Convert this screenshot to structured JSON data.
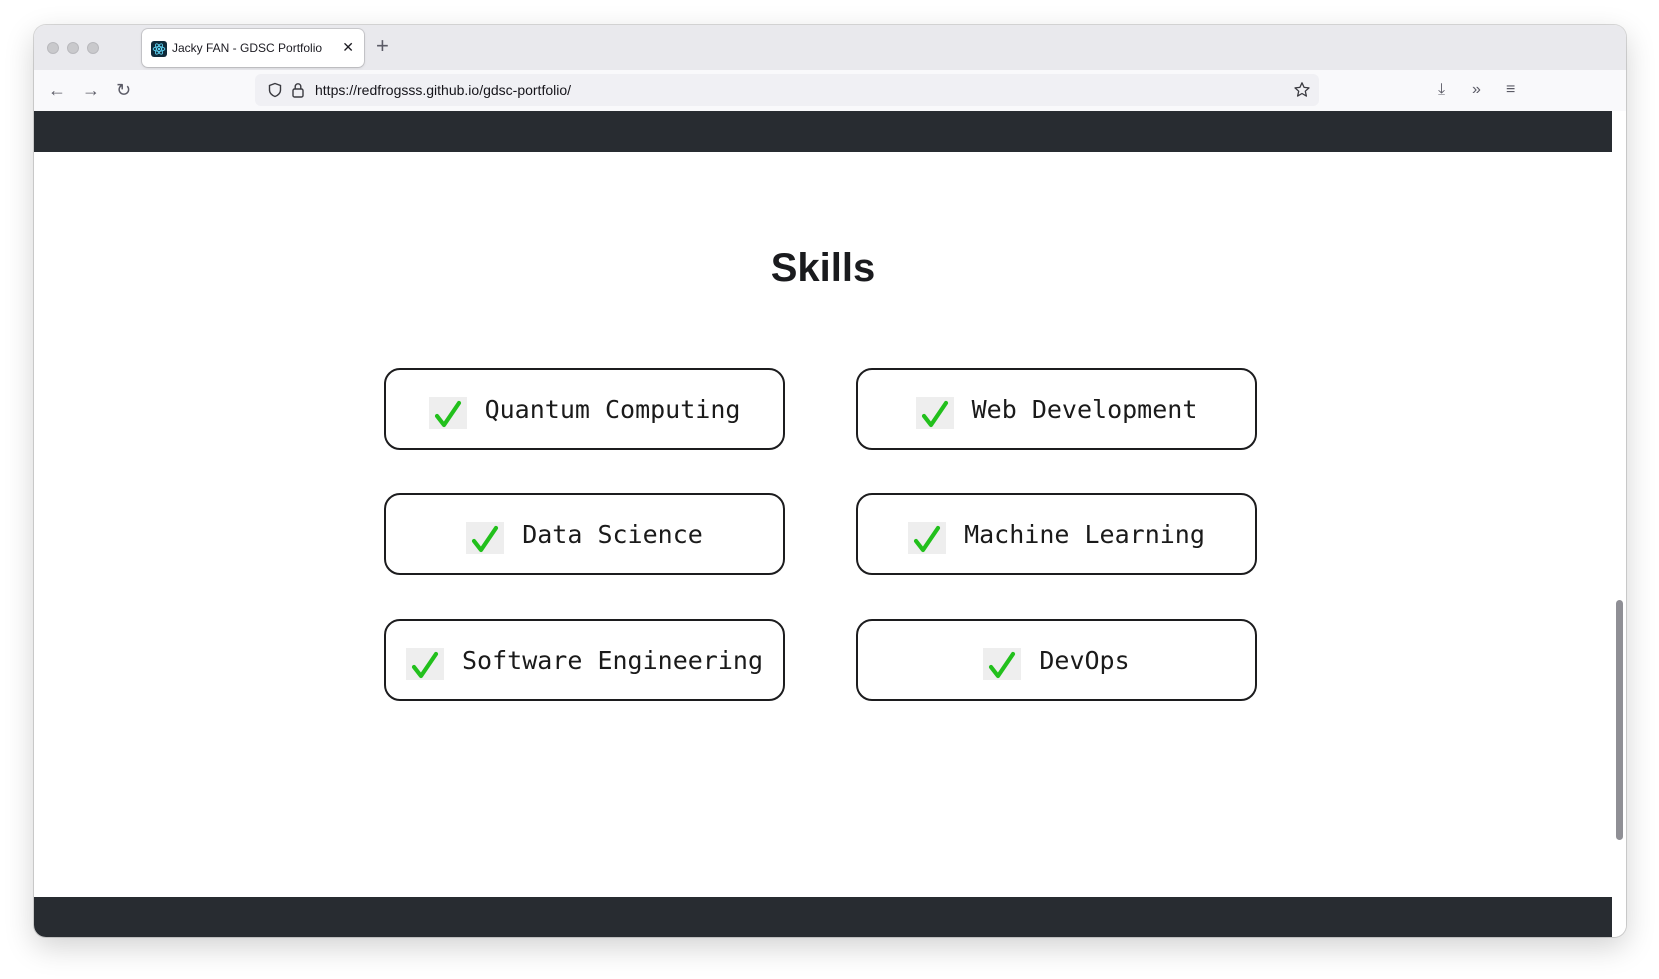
{
  "browser": {
    "tab": {
      "title": "Jacky FAN - GDSC Portfolio",
      "close_glyph": "✕",
      "favicon": "react-logo-icon"
    },
    "new_tab_glyph": "+",
    "nav": {
      "back_glyph": "←",
      "forward_glyph": "→",
      "reload_glyph": "↻"
    },
    "url": "https://redfrogsss.github.io/gdsc-portfolio/",
    "right_icons": {
      "download_glyph": "⤓",
      "overflow_glyph": "»",
      "menu_glyph": "≡"
    }
  },
  "page": {
    "section_title": "Skills",
    "skills": [
      {
        "label": "Quantum Computing"
      },
      {
        "label": "Web Development"
      },
      {
        "label": "Data Science"
      },
      {
        "label": "Machine Learning"
      },
      {
        "label": "Software Engineering"
      },
      {
        "label": "DevOps"
      }
    ],
    "colors": {
      "dark_bar": "#282c31",
      "check_green": "#22c01c",
      "card_border": "#1c1c1e"
    }
  }
}
